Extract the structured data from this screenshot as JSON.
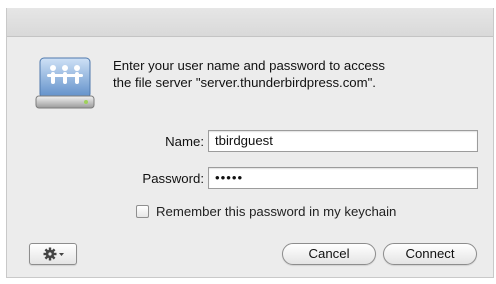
{
  "dialog": {
    "message_line1": "Enter your user name and password to access",
    "message_line2": "the file server \"server.thunderbirdpress.com\".",
    "name_label": "Name:",
    "name_value": "tbirdguest",
    "password_label": "Password:",
    "password_value": "•••••",
    "remember_label": "Remember this password in my keychain",
    "remember_checked": false,
    "cancel_label": "Cancel",
    "connect_label": "Connect",
    "gear_icon": "gear-icon",
    "server_icon": "file-server-icon"
  },
  "colors": {
    "accent": "#7aa6d8",
    "window_bg": "#ececec"
  }
}
